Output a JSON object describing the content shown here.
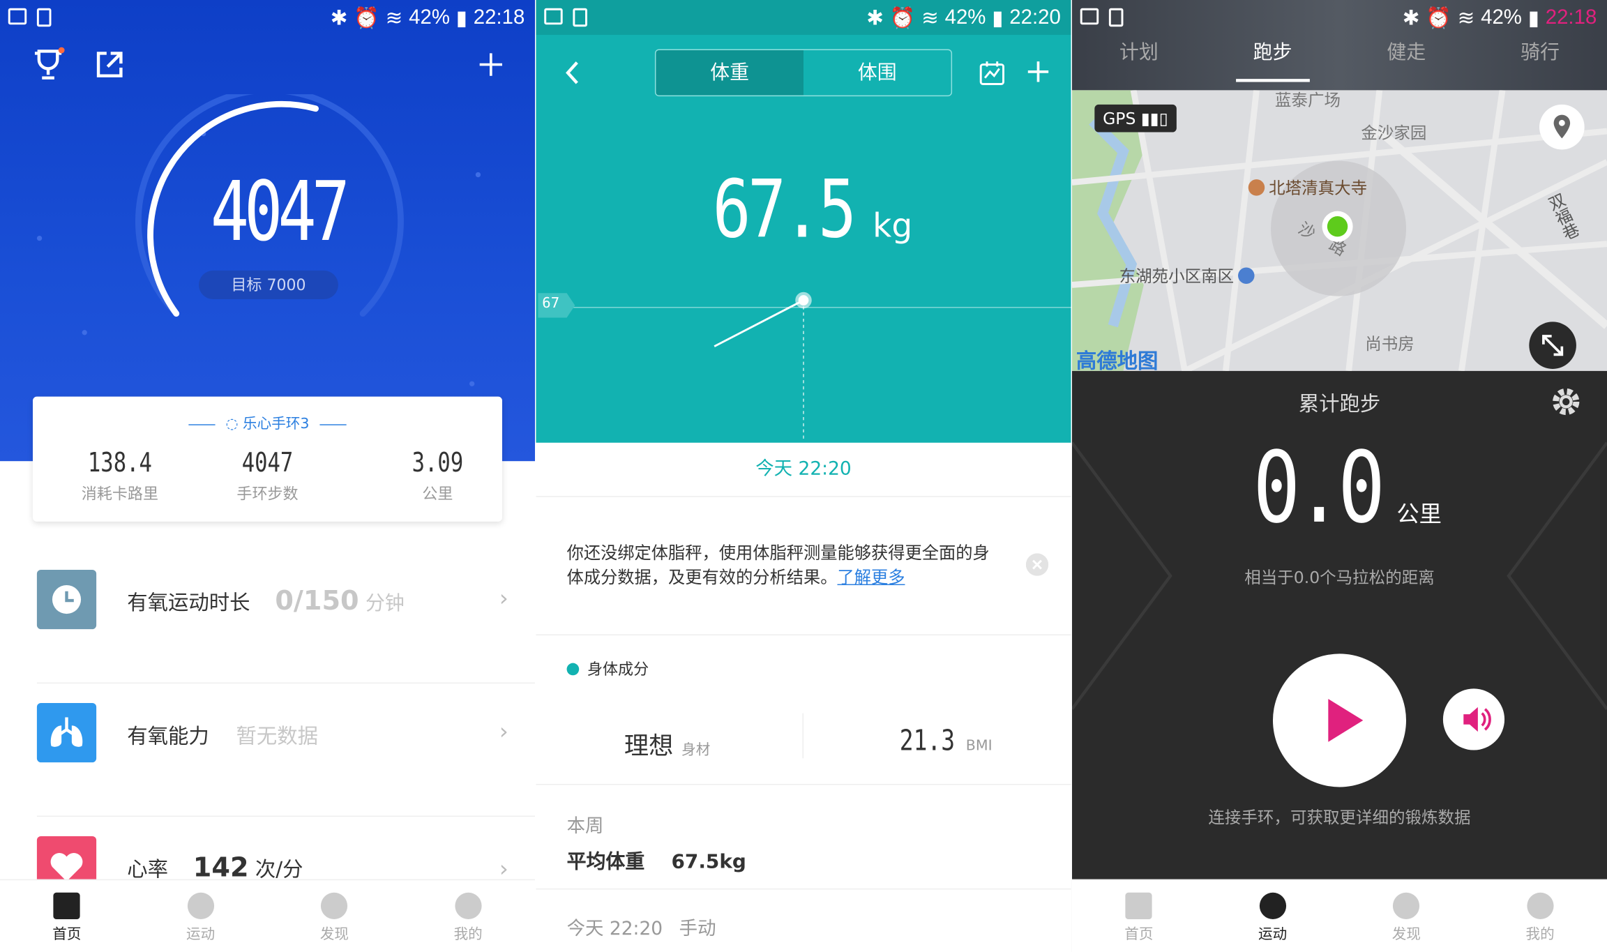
{
  "status_bars": [
    {
      "battery": "42%",
      "time": "22:18"
    },
    {
      "battery": "42%",
      "time": "22:20"
    },
    {
      "battery": "42%",
      "time": "22:18"
    }
  ],
  "home": {
    "steps": "4047",
    "goal": "目标 7000",
    "device_label": "乐心手环3",
    "stats": [
      {
        "value": "138.4",
        "label": "消耗卡路里"
      },
      {
        "value": "4047",
        "label": "手环步数"
      },
      {
        "value": "3.09",
        "label": "公里"
      }
    ],
    "rows": [
      {
        "title": "有氧运动时长",
        "value": "0/150",
        "unit": "分钟",
        "icon": "clock-icon",
        "color": "#6f9ab1"
      },
      {
        "title": "有氧能力",
        "value": "暂无数据",
        "unit": "",
        "icon": "lungs-icon",
        "color": "#2f99ee"
      },
      {
        "title": "心率",
        "value": "142",
        "unit": "次/分",
        "icon": "heart-icon",
        "color": "#ef4b6f"
      }
    ]
  },
  "weight": {
    "tabs": [
      "体重",
      "体围"
    ],
    "value": "67.5",
    "unit": "kg",
    "axis_label": "67",
    "date_label": "今天 22:20",
    "notice_text": "你还没绑定体脂秤，使用体脂秤测量能够获得更全面的身体成分数据，及更有效的分析结果。",
    "notice_link": "了解更多",
    "section_title": "身体成分",
    "body_type": "理想",
    "body_type_sub": "身材",
    "bmi": "21.3",
    "bmi_label": "BMI",
    "week_label": "本周",
    "avg_label": "平均体重",
    "avg_value": "67.5kg",
    "record_time": "今天 22:20",
    "record_method": "手动"
  },
  "run": {
    "tabs": [
      "计划",
      "跑步",
      "健走",
      "骑行"
    ],
    "gps_label": "GPS",
    "map_labels": [
      "蓝泰广场",
      "金沙家园",
      "北塔清真大寺",
      "东湖苑小区南区",
      "尚书房",
      "双福巷",
      "沙",
      "路"
    ],
    "map_brand": "高德地图",
    "title": "累计跑步",
    "distance": "0.0",
    "distance_unit": "公里",
    "marathon_text": "相当于0.0个马拉松的距离",
    "connect_text": "连接手环，可获取更详细的锻炼数据"
  },
  "nav": [
    "首页",
    "运动",
    "发现",
    "我的"
  ],
  "colors": {
    "home_blue": "#1a4fd6",
    "teal": "#12b2b1",
    "dark": "#2b2b2b",
    "play": "#e0217e"
  }
}
